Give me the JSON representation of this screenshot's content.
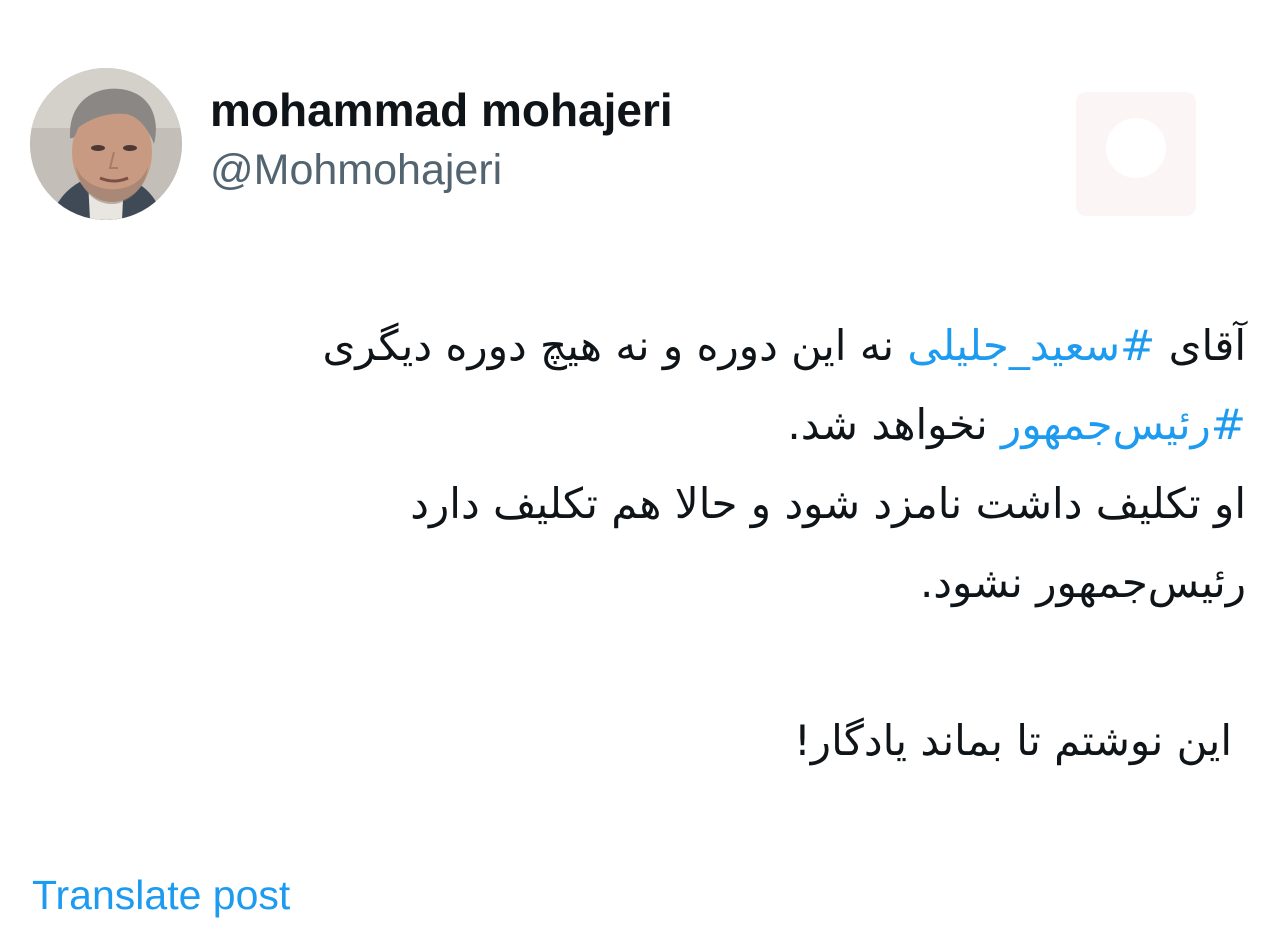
{
  "author": {
    "display_name": "mohammad mohajeri",
    "handle": "@Mohmohajeri"
  },
  "tweet": {
    "line1_text_before": "آقای ",
    "line1_hashtag": "#سعید_جلیلی",
    "line1_text_after": " نه این دوره و نه هیچ دوره دیگری",
    "line2_hashtag": "#رئیس‌جمهور",
    "line2_text_after": " نخواهد شد.",
    "line3": "او تکلیف داشت نامزد شود و حالا هم تکلیف دارد",
    "line4": "رئیس‌جمهور نشود.",
    "line5": "این نوشتم تا بماند یادگار!"
  },
  "actions": {
    "translate_label": "Translate post"
  },
  "colors": {
    "link": "#1d9bf0",
    "text": "#0f1419",
    "secondary": "#536471"
  },
  "icons": {
    "avatar": "profile-photo-icon",
    "watermark": "watermark-logo-icon"
  }
}
